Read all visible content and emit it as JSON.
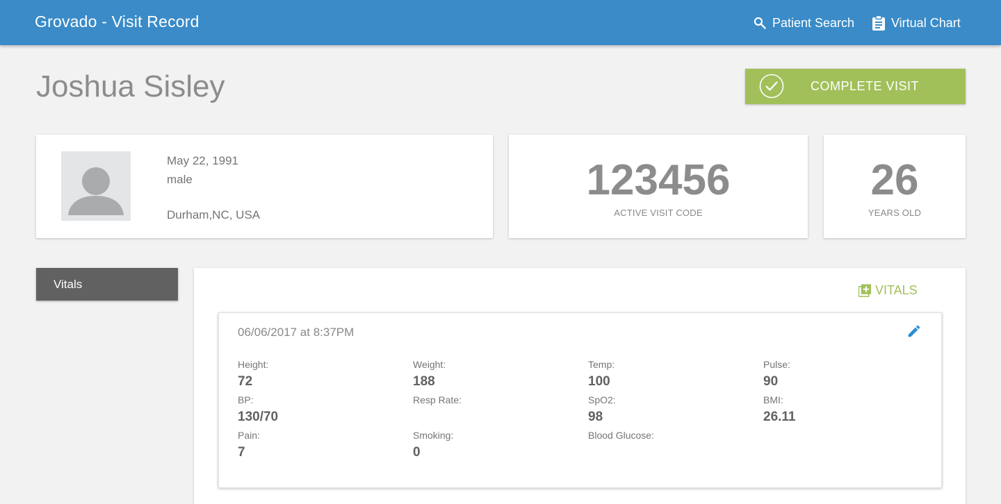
{
  "app": {
    "title": "Grovado - Visit Record"
  },
  "nav": {
    "patient_search": "Patient Search",
    "virtual_chart": "Virtual Chart"
  },
  "patient": {
    "name": "Joshua Sisley",
    "dob": "May 22, 1991",
    "sex": "male",
    "location": "Durham,NC, USA",
    "age": "26",
    "age_label": "YEARS OLD",
    "visit_code": "123456",
    "visit_code_label": "ACTIVE VISIT CODE"
  },
  "actions": {
    "complete_visit": "COMPLETE VISIT",
    "add_vitals": "VITALS"
  },
  "tabs": {
    "vitals": "Vitals"
  },
  "vitals_entry": {
    "timestamp": "06/06/2017 at 8:37PM",
    "fields": [
      {
        "label": "Height:",
        "value": "72"
      },
      {
        "label": "Weight:",
        "value": "188"
      },
      {
        "label": "Temp:",
        "value": "100"
      },
      {
        "label": "Pulse:",
        "value": "90"
      },
      {
        "label": "BP:",
        "value": "130/70"
      },
      {
        "label": "Resp Rate:",
        "value": ""
      },
      {
        "label": "SpO2:",
        "value": "98"
      },
      {
        "label": "BMI:",
        "value": "26.11"
      },
      {
        "label": "Pain:",
        "value": "7"
      },
      {
        "label": "Smoking:",
        "value": "0"
      },
      {
        "label": "Blood Glucose:",
        "value": ""
      }
    ]
  },
  "colors": {
    "header": "#3a8bc7",
    "accent_green": "#a1c05a",
    "edit_blue": "#2a8fd6",
    "tab_dark": "#616161"
  },
  "icons": {
    "search": "search-icon",
    "chart": "clipboard-icon",
    "check": "check-circle-icon",
    "add": "add-box-icon",
    "edit": "pencil-icon",
    "avatar": "person-silhouette-icon"
  }
}
